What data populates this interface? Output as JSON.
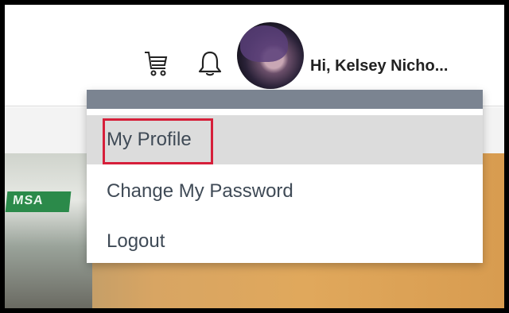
{
  "header": {
    "greeting": "Hi, Kelsey Nicho..."
  },
  "icons": {
    "cart": "cart-icon",
    "bell": "bell-icon"
  },
  "hero": {
    "badge_text": "MSA"
  },
  "menu": {
    "items": [
      {
        "label": "My Profile",
        "state": "hovered"
      },
      {
        "label": "Change My Password"
      },
      {
        "label": "Logout"
      }
    ]
  },
  "colors": {
    "menu_bar": "#7b8491",
    "hover_bg": "#dcdcdc",
    "highlight": "#d61f3a",
    "menu_text": "#3f4a56"
  }
}
